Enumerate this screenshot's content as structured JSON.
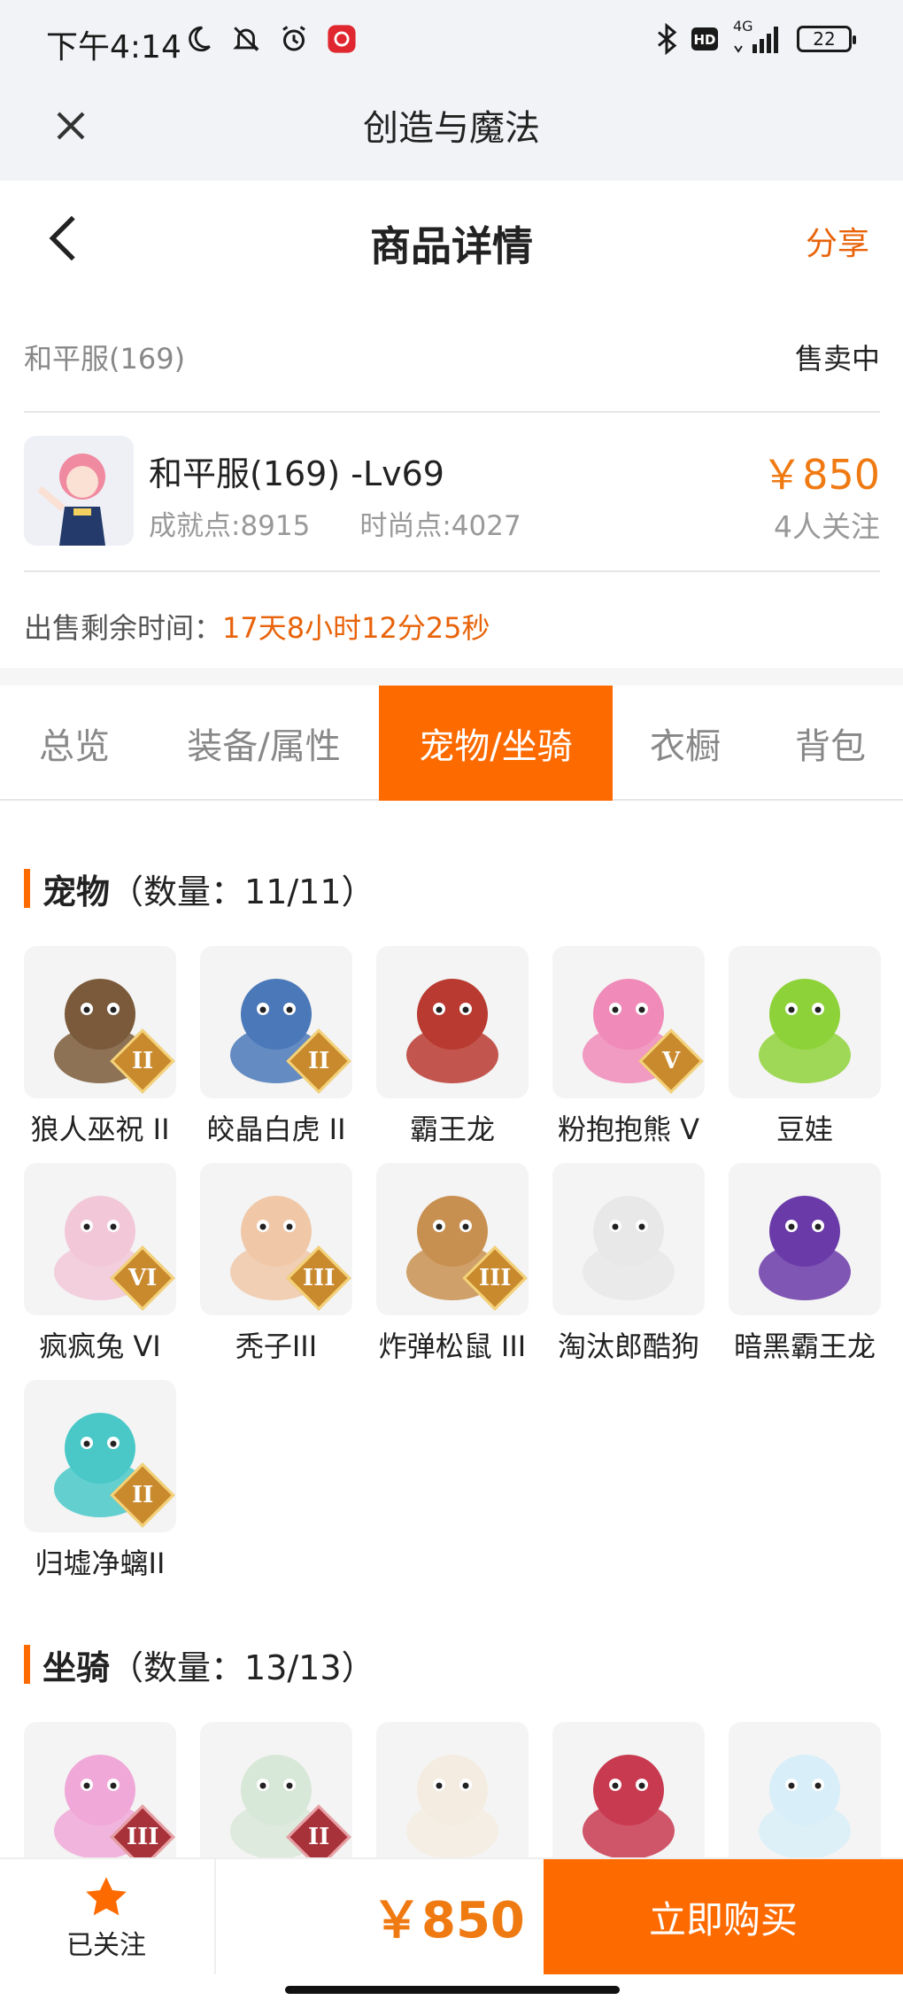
{
  "status_bar": {
    "time": "下午4:14",
    "network": "4G",
    "battery": "22",
    "icons": [
      "moon-icon",
      "bell-off-icon",
      "alarm-icon",
      "netease-music-icon",
      "bluetooth-icon",
      "hd-icon",
      "signal-icon",
      "battery-icon"
    ]
  },
  "app_bar": {
    "title": "创造与魔法",
    "close_icon": "close-icon"
  },
  "header": {
    "title": "商品详情",
    "share": "分享",
    "back_icon": "back-icon"
  },
  "product": {
    "server": "和平服(169)",
    "status": "售卖中",
    "name": "和平服(169) -Lv69",
    "achievement": "成就点:8915",
    "fashion": "时尚点:4027",
    "price": "￥850",
    "followers": "4人关注",
    "remaining_label": "出售剩余时间：",
    "remaining_value": "17天8小时12分25秒"
  },
  "tabs": [
    {
      "label": "总览",
      "active": false
    },
    {
      "label": "装备/属性",
      "active": false
    },
    {
      "label": "宠物/坐骑",
      "active": true
    },
    {
      "label": "衣橱",
      "active": false
    },
    {
      "label": "背包",
      "active": false
    }
  ],
  "pets": {
    "title": "宠物",
    "count": "（数量：11/11）",
    "items": [
      {
        "name": "狼人巫祝 II",
        "tier": "II",
        "color": "#7a5a3a"
      },
      {
        "name": "皎晶白虎 II",
        "tier": "II",
        "color": "#4a78b8"
      },
      {
        "name": "霸王龙",
        "tier": "",
        "color": "#b83a30"
      },
      {
        "name": "粉抱抱熊 V",
        "tier": "V",
        "color": "#f08ab8"
      },
      {
        "name": "豆娃",
        "tier": "",
        "color": "#8ed23a"
      },
      {
        "name": "疯疯兔 VI",
        "tier": "VI",
        "color": "#f2c8d8"
      },
      {
        "name": "秃子III",
        "tier": "III",
        "color": "#f0c8a8"
      },
      {
        "name": "炸弹松鼠 III",
        "tier": "III",
        "color": "#c89050"
      },
      {
        "name": "淘汰郎酷狗",
        "tier": "",
        "color": "#e8e8e8"
      },
      {
        "name": "暗黑霸王龙",
        "tier": "",
        "color": "#6a3aa8"
      },
      {
        "name": "归墟净螭II",
        "tier": "II",
        "color": "#4ac8c8"
      }
    ]
  },
  "mounts": {
    "title": "坐骑",
    "count": "（数量：13/13）",
    "items": [
      {
        "tier": "III",
        "color": "#f0a8d8"
      },
      {
        "tier": "II",
        "color": "#d8e8d8"
      },
      {
        "tier": "",
        "color": "#f4ece0"
      },
      {
        "tier": "",
        "color": "#c83a50"
      },
      {
        "tier": "",
        "color": "#d8eef8"
      }
    ]
  },
  "bottom_bar": {
    "follow_label": "已关注",
    "price": "￥850",
    "buy_label": "立即购买"
  }
}
